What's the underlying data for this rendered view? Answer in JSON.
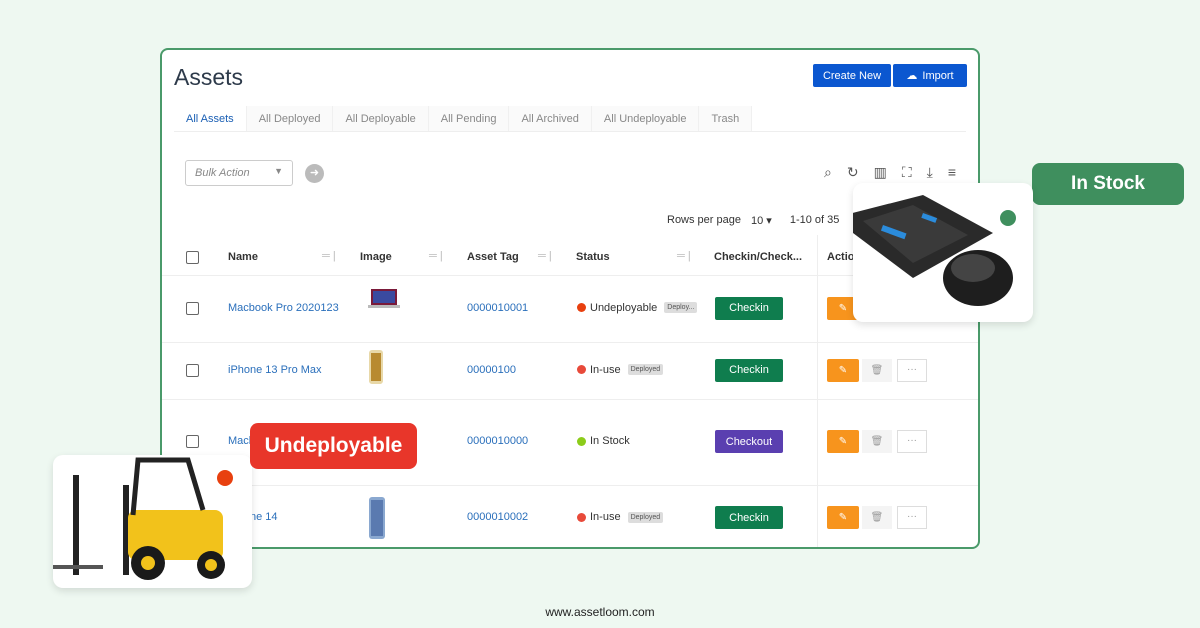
{
  "page": {
    "title": "Assets",
    "create_label": "Create New",
    "import_label": "Import"
  },
  "tabs": [
    {
      "label": "All Assets",
      "active": true
    },
    {
      "label": "All Deployed"
    },
    {
      "label": "All Deployable"
    },
    {
      "label": "All Pending"
    },
    {
      "label": "All Archived"
    },
    {
      "label": "All Undeployable"
    },
    {
      "label": "Trash"
    }
  ],
  "toolbar": {
    "bulk_placeholder": "Bulk Action",
    "icons": [
      "search-icon",
      "refresh-icon",
      "columns-icon",
      "fullscreen-icon",
      "download-icon",
      "filter-icon"
    ]
  },
  "pagination": {
    "rows_label": "Rows per page",
    "rows_value": "10",
    "range": "1-10 of 35"
  },
  "columns": [
    "Name",
    "Image",
    "Asset Tag",
    "Status",
    "Checkin/Check...",
    "Actio"
  ],
  "rows": [
    {
      "name": "Macbook Pro 2020123",
      "tag": "0000010001",
      "status": "Undeployable",
      "pill": "Deploy...",
      "dot": "#e8400f",
      "action": "Checkin",
      "action_color": "#0f7d4e"
    },
    {
      "name": "iPhone 13 Pro Max",
      "tag": "00000100",
      "status": "In-use",
      "pill": "Deployed",
      "dot": "#e84a3a",
      "action": "Checkin",
      "action_color": "#0f7d4e"
    },
    {
      "name": "Macb",
      "tag": "0000010000",
      "status": "In Stock",
      "pill": "",
      "dot": "#8ccc1a",
      "action": "Checkout",
      "action_color": "#5a3fb0"
    },
    {
      "name": "iPhone 14",
      "tag": "0000010002",
      "status": "In-use",
      "pill": "Deployed",
      "dot": "#e84a3a",
      "action": "Checkin",
      "action_color": "#0f7d4e"
    }
  ],
  "overlays": {
    "in_stock": "In Stock",
    "undeployable": "Undeployable"
  },
  "colors": {
    "primary": "#0b57d0",
    "in_stock_badge": "#3f8f5e",
    "undeployable_badge": "#e8362a",
    "edit": "#f7941d"
  },
  "footer": "www.assetloom.com"
}
